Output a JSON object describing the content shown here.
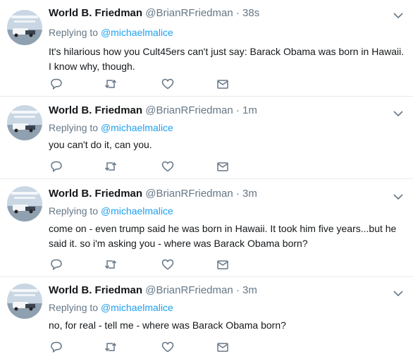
{
  "theme": {
    "link_color": "#1da1f2",
    "muted_color": "#657786",
    "icon_color": "#657786",
    "divider_color": "#e6ecf0"
  },
  "tweets": [
    {
      "name": "World B. Friedman",
      "handle": "@BrianRFriedman",
      "dot": "·",
      "time": "38s",
      "reply_prefix": "Replying to",
      "reply_to": "@michaelmalice",
      "text": "It's hilarious how you Cult45ers can't just say: Barack Obama was born in Hawaii. I know why, though."
    },
    {
      "name": "World B. Friedman",
      "handle": "@BrianRFriedman",
      "dot": "·",
      "time": "1m",
      "reply_prefix": "Replying to",
      "reply_to": "@michaelmalice",
      "text": "you can't do it, can you."
    },
    {
      "name": "World B. Friedman",
      "handle": "@BrianRFriedman",
      "dot": "·",
      "time": "3m",
      "reply_prefix": "Replying to",
      "reply_to": "@michaelmalice",
      "text": "come on - even trump said he was born in Hawaii.  It took him five years...but he said it. so i'm asking you - where was Barack Obama born?"
    },
    {
      "name": "World B. Friedman",
      "handle": "@BrianRFriedman",
      "dot": "·",
      "time": "3m",
      "reply_prefix": "Replying to",
      "reply_to": "@michaelmalice",
      "text": "no, for real - tell me - where was Barack Obama born?"
    }
  ],
  "icons": {
    "reply": "reply-icon",
    "retweet": "retweet-icon",
    "like": "like-icon",
    "message": "direct-message-icon",
    "menu": "chevron-down-icon"
  }
}
